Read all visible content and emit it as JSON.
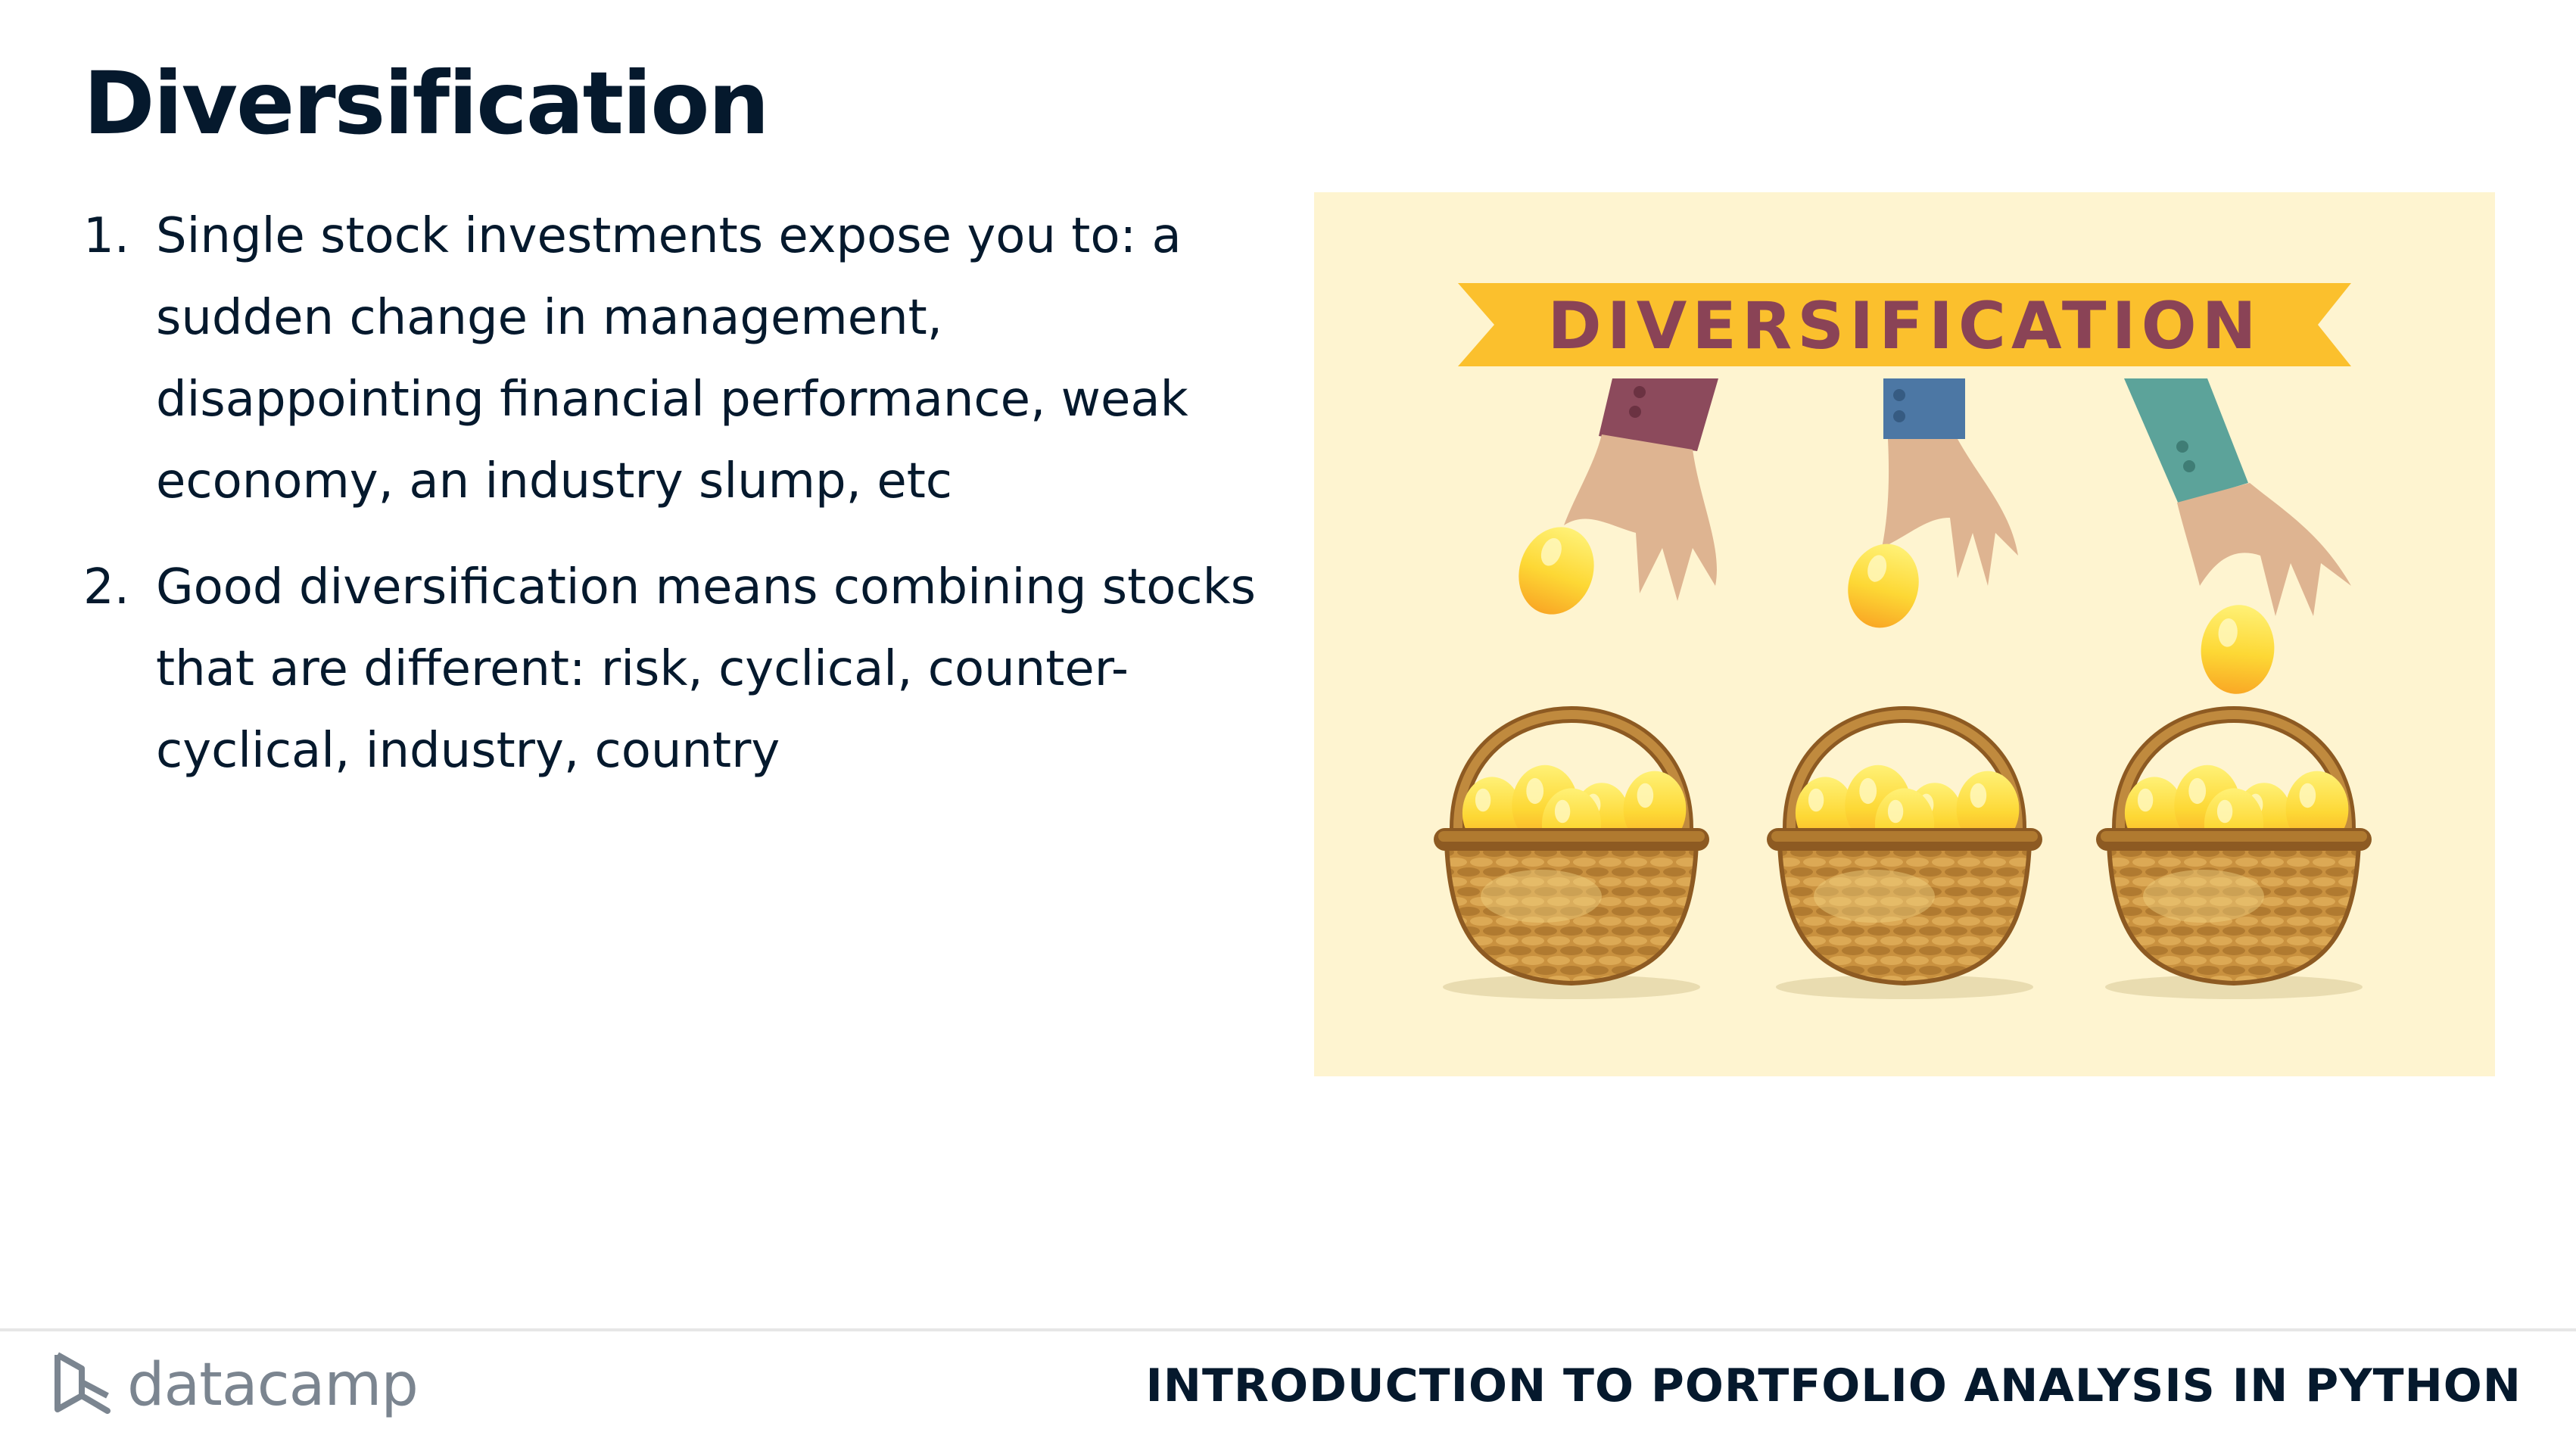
{
  "slide": {
    "title": "Diversification",
    "bullets": [
      {
        "num": "1.",
        "text": "Single stock investments expose you to: a sudden change in management, disappointing financial performance, weak economy, an industry slump, etc"
      },
      {
        "num": "2.",
        "text": "Good diversification means combining stocks that are different: risk, cyclical, counter-cyclical, industry, country"
      }
    ]
  },
  "illustration": {
    "banner_text": "DIVERSIFICATION",
    "icons": [
      "hand-icon",
      "golden-egg-icon",
      "wicker-basket-icon"
    ]
  },
  "footer": {
    "logo_text": "datacamp",
    "course_title": "INTRODUCTION TO PORTFOLIO ANALYSIS IN PYTHON"
  },
  "colors": {
    "text": "#05192d",
    "ribbon": "#fbc02d",
    "ribbon_text": "#8a4356",
    "illustration_bg": "#fef4d0",
    "egg": "#fdd835",
    "basket": "#c08a3e",
    "sleeve_left": "#8c4a5c",
    "sleeve_middle": "#4c77a4",
    "sleeve_right": "#5ca39a"
  }
}
